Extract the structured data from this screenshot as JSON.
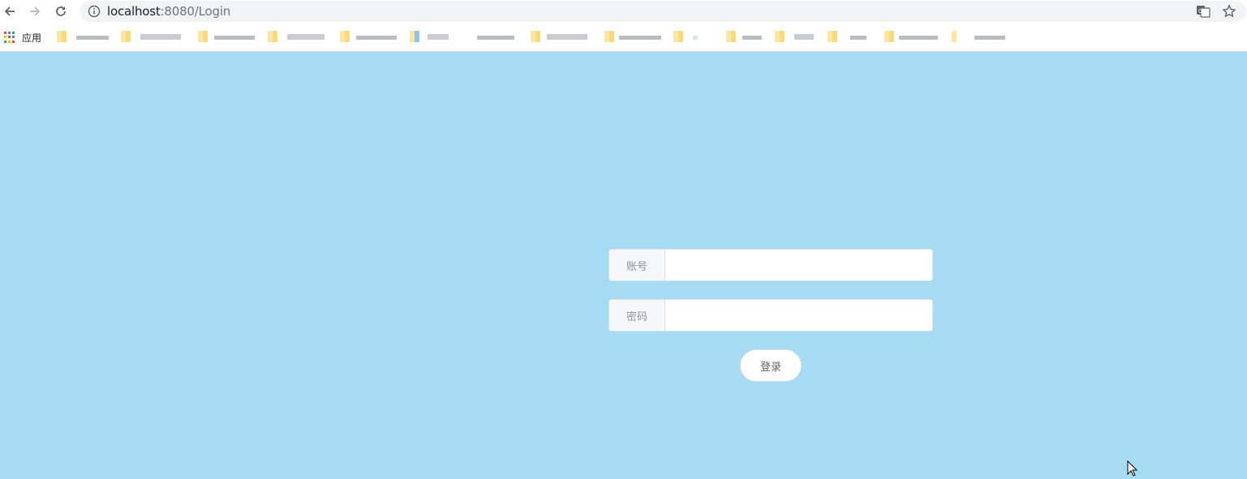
{
  "browser": {
    "url_host": "localhost",
    "url_rest": ":8080/Login",
    "bookmarks_bar": {
      "apps_label": "应用"
    }
  },
  "login_form": {
    "account_label": "账号",
    "account_value": "",
    "password_label": "密码",
    "password_value": "",
    "submit_label": "登录"
  },
  "colors": {
    "page_background": "#a6dbf4",
    "input_border": "#dcdfe6",
    "prepend_background": "#f5f7fa"
  }
}
